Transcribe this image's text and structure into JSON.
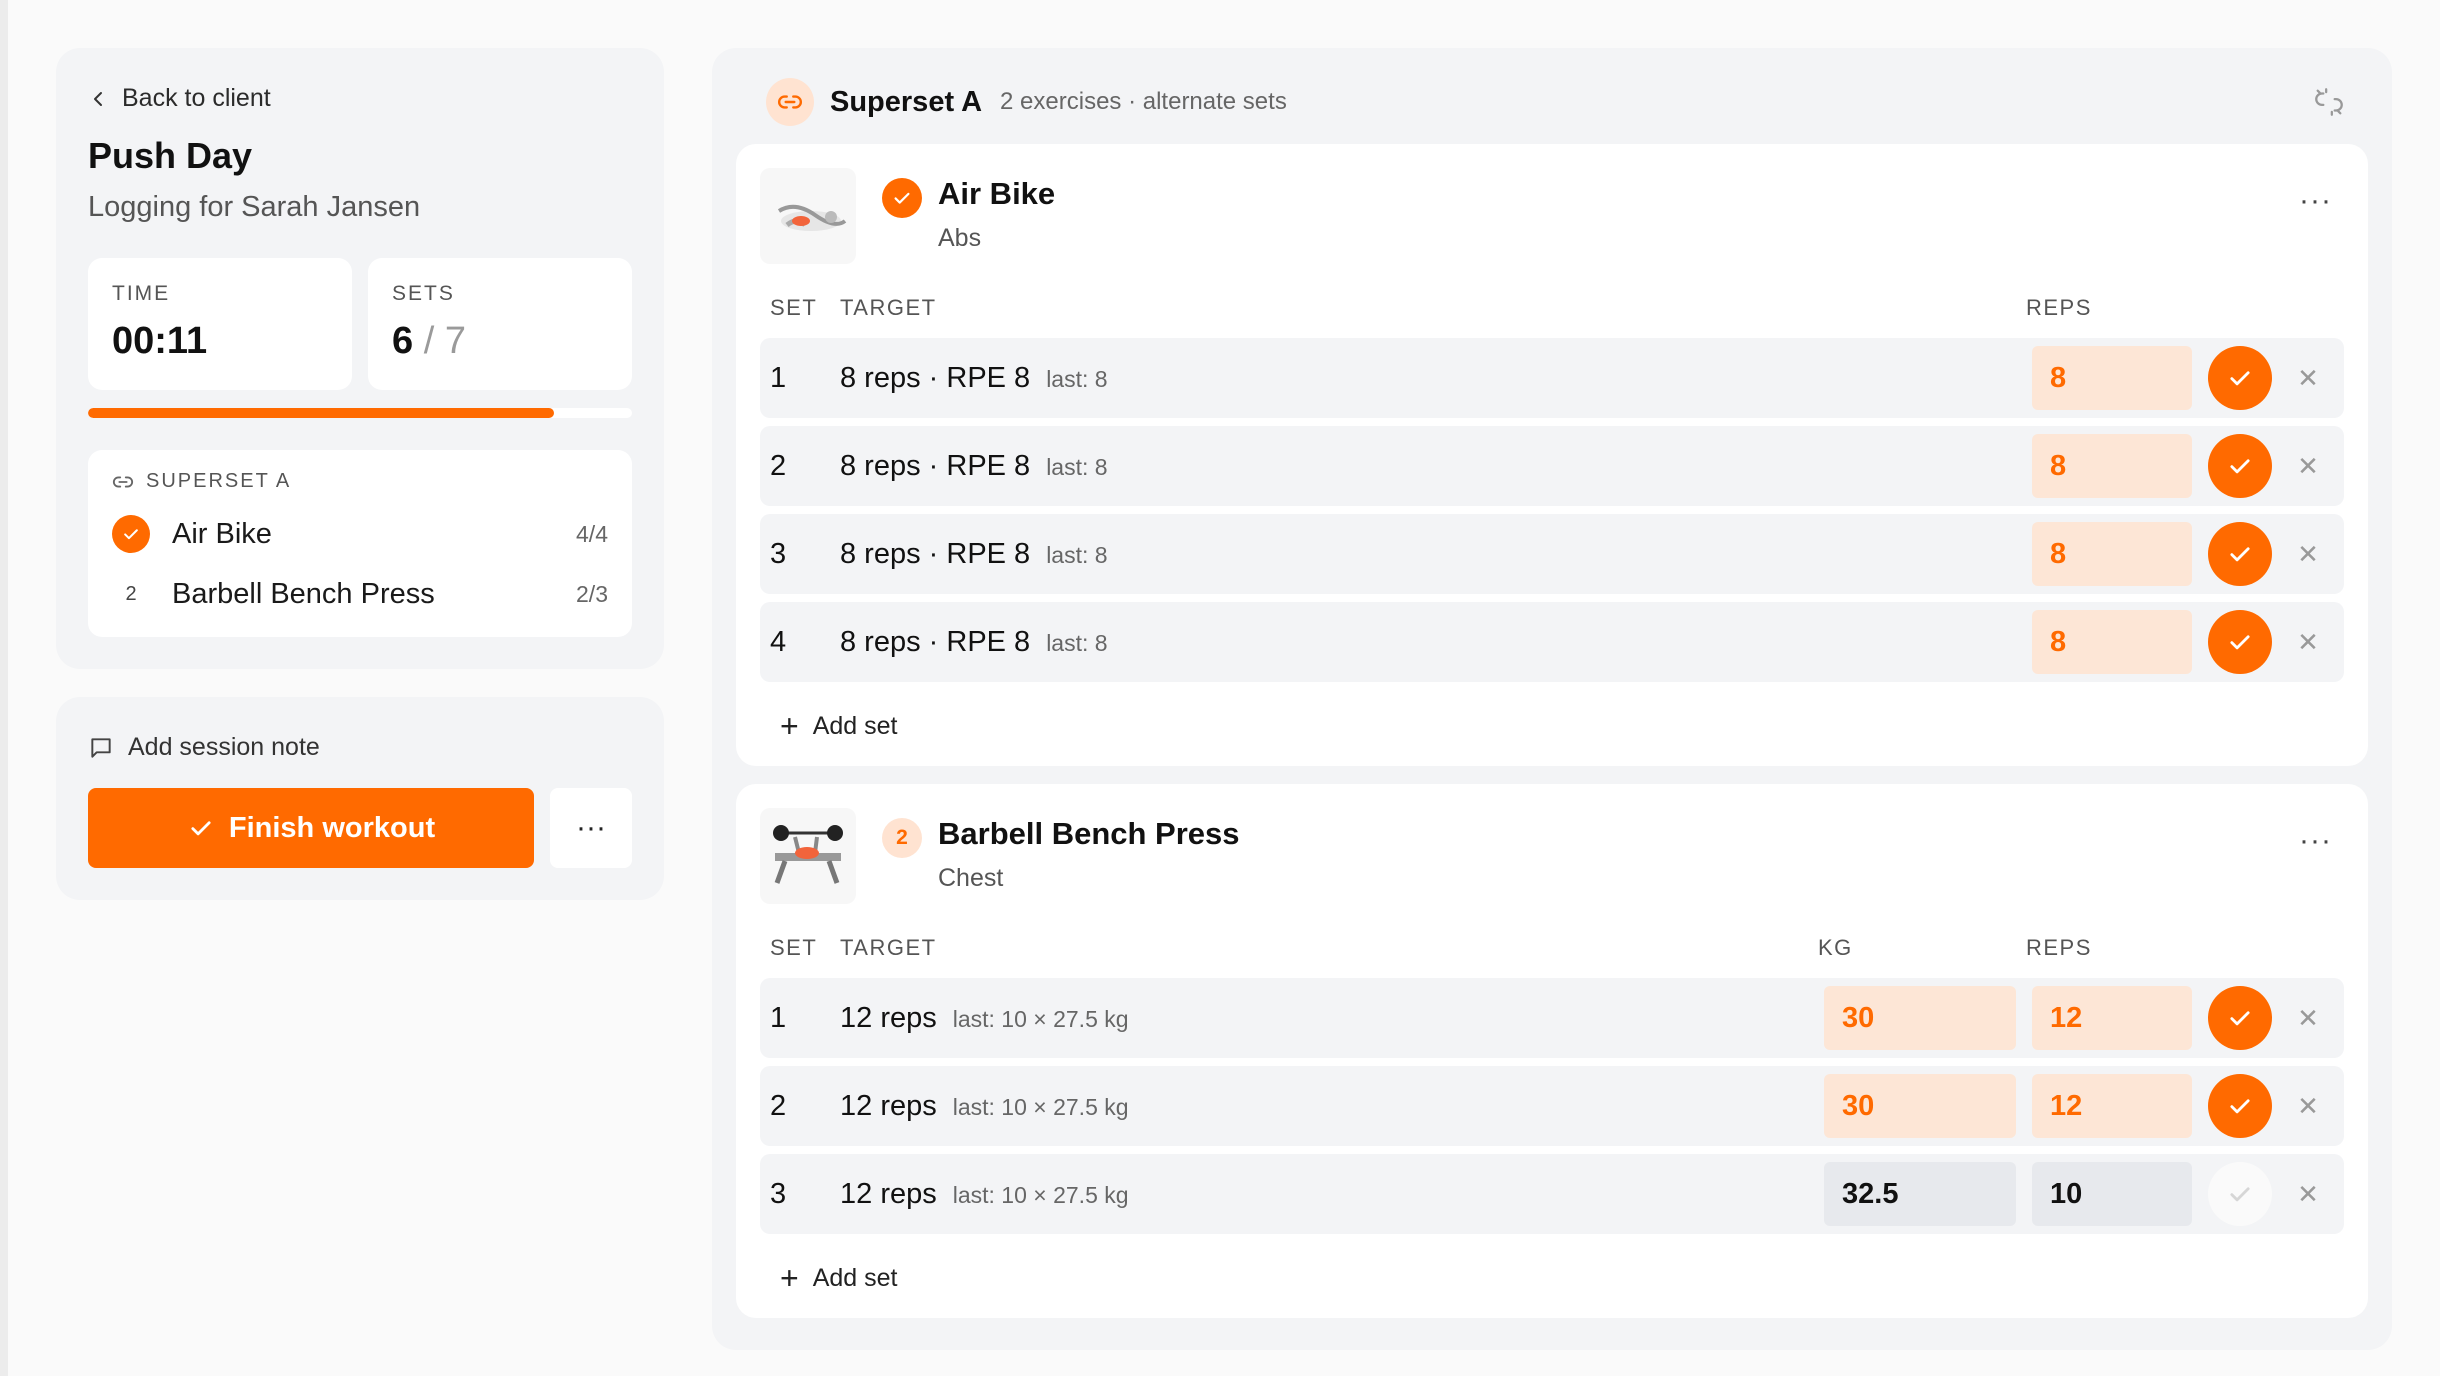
{
  "colors": {
    "accent": "#ff6a00",
    "accent_soft": "#fde6d6",
    "panel": "#f3f4f6"
  },
  "left": {
    "back_label": "Back to client",
    "title": "Push Day",
    "subtitle": "Logging for Sarah Jansen",
    "time": {
      "label": "TIME",
      "value": "00:11"
    },
    "sets": {
      "label": "SETS",
      "done": "6",
      "separator": "/",
      "total": "7"
    },
    "progress": 0.857,
    "superset": {
      "label": "SUPERSET A",
      "items": [
        {
          "index": "",
          "name": "Air Bike",
          "count": "4/4",
          "done": true
        },
        {
          "index": "2",
          "name": "Barbell Bench Press",
          "count": "2/3",
          "done": false
        }
      ]
    },
    "note_label": "Add session note",
    "finish_label": "Finish workout",
    "more_label": "···"
  },
  "superset": {
    "title": "Superset A",
    "description": "2 exercises · alternate sets",
    "unlink_icon": "unlink-icon"
  },
  "exercises": [
    {
      "name": "Air Bike",
      "muscle": "Abs",
      "badge": "",
      "done": true,
      "more_label": "···",
      "columns": {
        "set": "SET",
        "target": "TARGET",
        "kg": "",
        "reps": "REPS"
      },
      "sets": [
        {
          "set": "1",
          "target": "8 reps · RPE 8",
          "last": "last: 8",
          "reps": "8",
          "logged": true
        },
        {
          "set": "2",
          "target": "8 reps · RPE 8",
          "last": "last: 8",
          "reps": "8",
          "logged": true
        },
        {
          "set": "3",
          "target": "8 reps · RPE 8",
          "last": "last: 8",
          "reps": "8",
          "logged": true
        },
        {
          "set": "4",
          "target": "8 reps · RPE 8",
          "last": "last: 8",
          "reps": "8",
          "logged": true
        }
      ],
      "add_set_label": "Add set"
    },
    {
      "name": "Barbell Bench Press",
      "muscle": "Chest",
      "badge": "2",
      "done": false,
      "more_label": "···",
      "columns": {
        "set": "SET",
        "target": "TARGET",
        "kg": "KG",
        "reps": "REPS"
      },
      "sets": [
        {
          "set": "1",
          "target": "12 reps",
          "last": "last: 10 × 27.5 kg",
          "kg": "30",
          "reps": "12",
          "logged": true
        },
        {
          "set": "2",
          "target": "12 reps",
          "last": "last: 10 × 27.5 kg",
          "kg": "30",
          "reps": "12",
          "logged": true
        },
        {
          "set": "3",
          "target": "12 reps",
          "last": "last: 10 × 27.5 kg",
          "kg": "32.5",
          "reps": "10",
          "logged": false
        }
      ],
      "add_set_label": "Add set"
    }
  ]
}
